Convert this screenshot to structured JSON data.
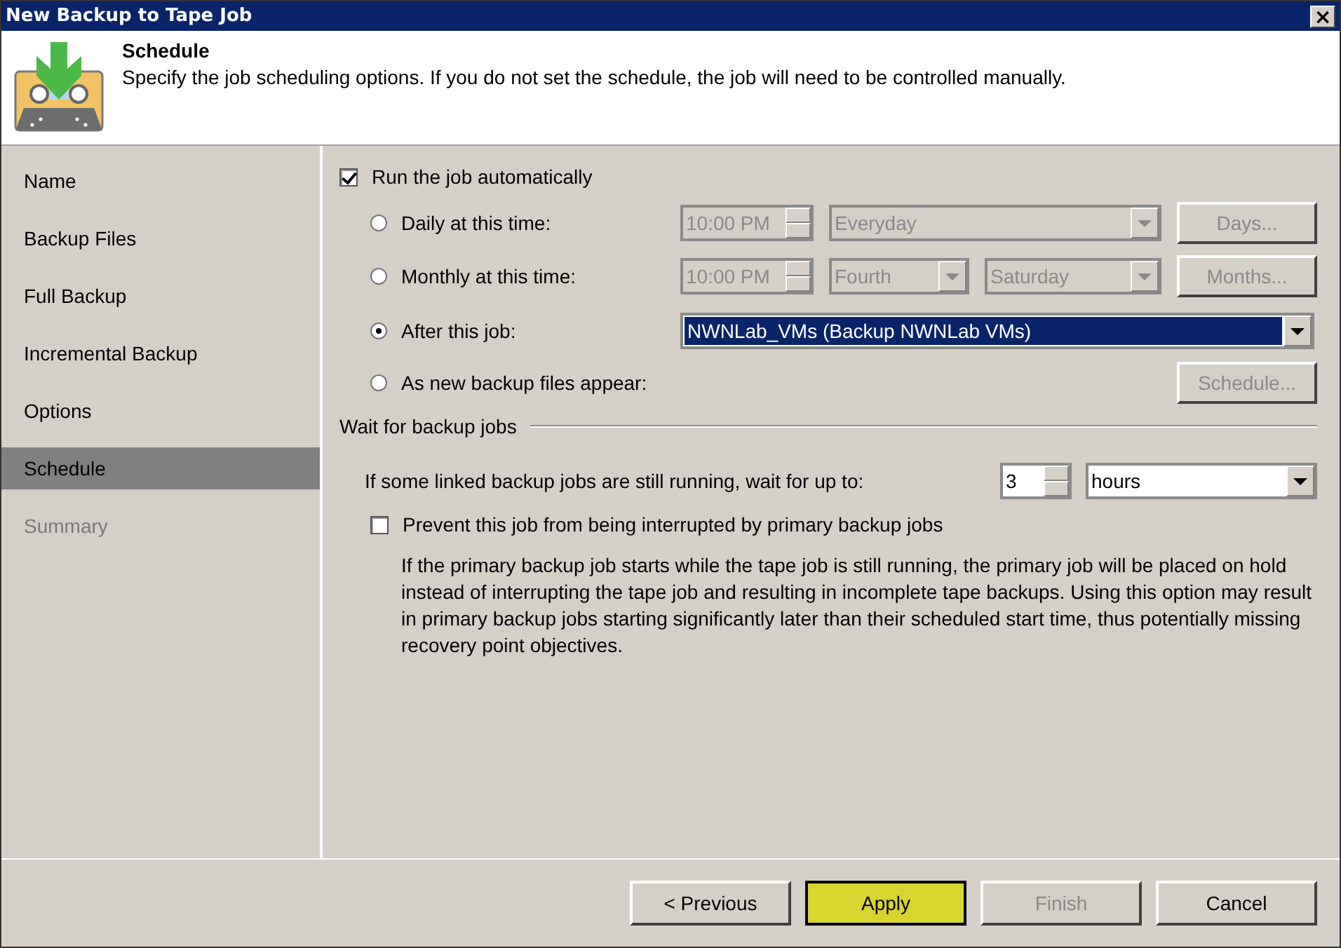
{
  "window": {
    "title": "New Backup to Tape Job",
    "close": "×"
  },
  "header": {
    "title": "Schedule",
    "description": "Specify the job scheduling options. If you do not set the schedule, the job will need to be controlled manually."
  },
  "sidebar": {
    "items": [
      {
        "label": "Name",
        "selected": false,
        "disabled": false
      },
      {
        "label": "Backup Files",
        "selected": false,
        "disabled": false
      },
      {
        "label": "Full Backup",
        "selected": false,
        "disabled": false
      },
      {
        "label": "Incremental Backup",
        "selected": false,
        "disabled": false
      },
      {
        "label": "Options",
        "selected": false,
        "disabled": false
      },
      {
        "label": "Schedule",
        "selected": true,
        "disabled": false
      },
      {
        "label": "Summary",
        "selected": false,
        "disabled": true
      }
    ]
  },
  "run_automatically": {
    "label": "Run the job automatically",
    "checked": true
  },
  "schedule_options": [
    {
      "kind": "time",
      "label": "Daily at this time:",
      "selected": false,
      "time": "10:00 PM",
      "selects": [
        {
          "value": "Everyday"
        }
      ],
      "button": "Days..."
    },
    {
      "kind": "time",
      "label": "Monthly at this time:",
      "selected": false,
      "time": "10:00 PM",
      "selects": [
        {
          "value": "Fourth"
        },
        {
          "value": "Saturday"
        }
      ],
      "button": "Months..."
    },
    {
      "kind": "job",
      "label": "After this job:",
      "selected": true,
      "job": "NWNLab_VMs (Backup NWNLab VMs)"
    },
    {
      "kind": "files",
      "label": "As new backup files appear:",
      "selected": false,
      "button": "Schedule..."
    }
  ],
  "wait_group": {
    "title": "Wait for backup jobs",
    "wait_label": "If some linked backup jobs are still running, wait for up to:",
    "wait_value": "3",
    "wait_unit": "hours",
    "prevent": {
      "label": "Prevent this job from being interrupted by primary backup jobs",
      "checked": false
    },
    "note": "If the primary backup job starts while the tape job is still running, the primary job will be placed on hold instead of interrupting the tape job and resulting in incomplete tape backups. Using this option may result in primary backup jobs starting significantly later than their scheduled start time, thus potentially missing recovery point objectives."
  },
  "buttons": [
    {
      "label": "< Previous",
      "kind": "normal",
      "disabled": false
    },
    {
      "label": "Apply",
      "kind": "default",
      "disabled": false
    },
    {
      "label": "Finish",
      "kind": "normal",
      "disabled": true
    },
    {
      "label": "Cancel",
      "kind": "normal",
      "disabled": false
    }
  ]
}
